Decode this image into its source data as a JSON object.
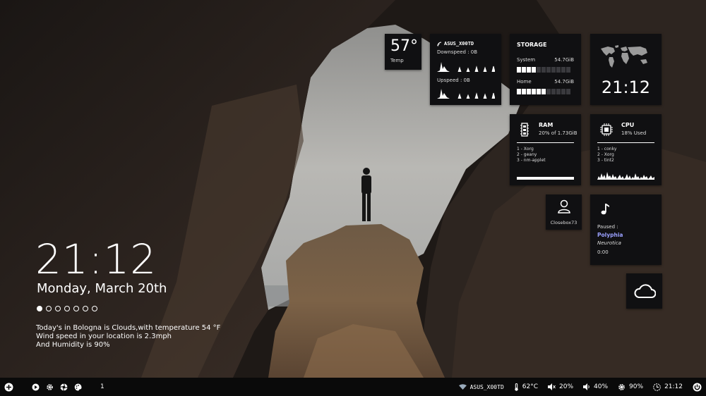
{
  "widgets": {
    "temp": {
      "value": "57°",
      "label": "Temp"
    },
    "network": {
      "ssid": "ASUS_X00TD",
      "downspeed_label": "Downspeed : 0B",
      "upspeed_label": "Upspeed : 0B"
    },
    "storage": {
      "title": "STORAGE",
      "system_label": "System",
      "system_value": "54.7GiB",
      "system_fraction": 0.35,
      "home_label": "Home",
      "home_value": "54.7GiB",
      "home_fraction": 0.55
    },
    "world_clock": {
      "time": "21:12"
    },
    "ram": {
      "title": "RAM",
      "usage": "20% of 1.73GiB",
      "processes": [
        "1 - Xorg",
        "2 - geany",
        "3 - nm-applet"
      ]
    },
    "cpu": {
      "title": "CPU",
      "usage": "18% Used",
      "processes": [
        "1 - conky",
        "2 - Xorg",
        "3 - tint2"
      ]
    },
    "user": {
      "name": "Closebox73"
    },
    "music": {
      "status": "Paused :",
      "artist": "Polyphia",
      "album": "Neurotica",
      "time": "0:00"
    },
    "weather_icon": "cloud-icon"
  },
  "desktop": {
    "clock": "21:12",
    "date": "Monday, March 20th",
    "weather_lines": [
      "Today's in Bologna is Clouds,with temperature 54 °F",
      "Wind speed in your location is 2.3mph",
      "And Humidity is 90%"
    ],
    "workspace_dots": 7,
    "active_dot": 0
  },
  "taskbar": {
    "workspace": "1",
    "wifi": "ASUS_X00TD",
    "temp": "62°C",
    "volume_muted_level": "20%",
    "volume": "40%",
    "brightness": "90%",
    "time": "21:12"
  },
  "colors": {
    "widget_bg": "#101012",
    "taskbar_bg": "#0a0a0a",
    "accent": "#ffffff",
    "music_artist": "#9aa0ff"
  }
}
